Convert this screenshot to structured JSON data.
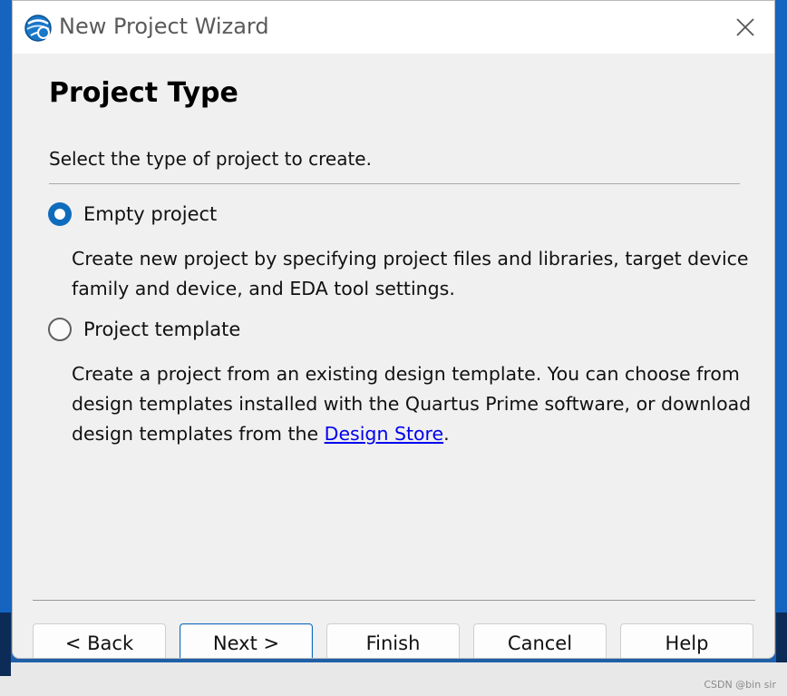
{
  "window": {
    "title": "New Project Wizard",
    "app_icon": "quartus-globe-icon",
    "close_icon": "close-icon"
  },
  "page": {
    "heading": "Project Type",
    "subtitle": "Select the type of project to create."
  },
  "options": [
    {
      "label": "Empty project",
      "selected": true,
      "description": "Create new project by specifying project files and libraries, target device family and device, and EDA tool settings."
    },
    {
      "label": "Project template",
      "selected": false,
      "description_prefix": "Create a project from an existing design template. You can choose from design templates installed with the Quartus Prime software, or download design templates from the ",
      "description_link": "Design Store",
      "description_suffix": "."
    }
  ],
  "buttons": {
    "back": "< Back",
    "next": "Next >",
    "finish": "Finish",
    "cancel": "Cancel",
    "help": "Help"
  },
  "watermark": "CSDN @bin sir",
  "colors": {
    "accent": "#0f6cbd",
    "link": "#0000ee",
    "dialog_bg": "#f0f0f0",
    "titlebar_bg": "#ffffff"
  }
}
